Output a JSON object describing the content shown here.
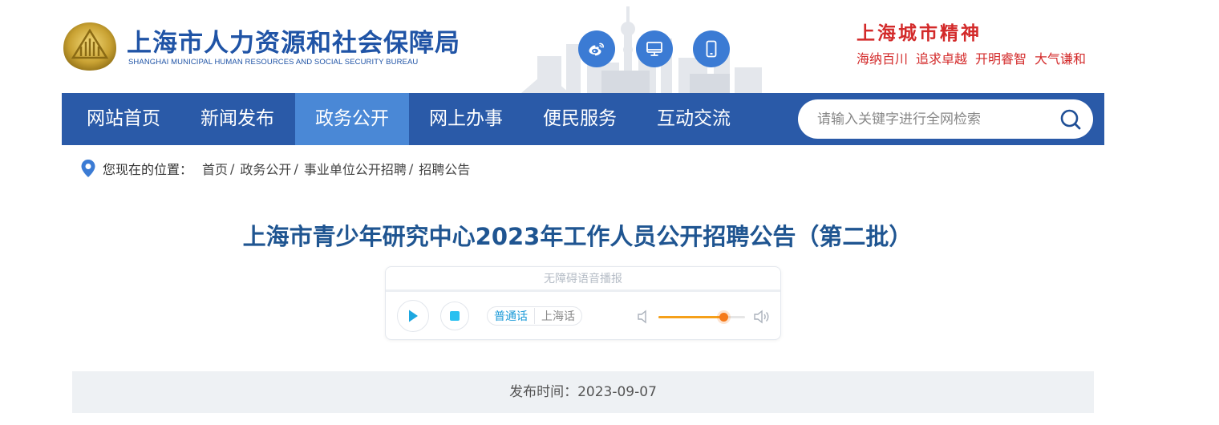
{
  "header": {
    "site_name_cn": "上海市人力资源和社会保障局",
    "site_name_en": "SHANGHAI MUNICIPAL HUMAN RESOURCES AND SOCIAL SECURITY BUREAU",
    "icons": [
      "weibo-icon",
      "desktop-icon",
      "mobile-icon"
    ],
    "city_spirit_title": "上海城市精神",
    "city_spirit_words": [
      "海纳百川",
      "追求卓越",
      "开明睿智",
      "大气谦和"
    ]
  },
  "nav": {
    "items": [
      {
        "label": "网站首页",
        "active": false
      },
      {
        "label": "新闻发布",
        "active": false
      },
      {
        "label": "政务公开",
        "active": true
      },
      {
        "label": "网上办事",
        "active": false
      },
      {
        "label": "便民服务",
        "active": false
      },
      {
        "label": "互动交流",
        "active": false
      }
    ],
    "search_placeholder": "请输入关键字进行全网检索"
  },
  "breadcrumb": {
    "prefix": "您现在的位置：",
    "items": [
      "首页",
      "政务公开",
      "事业单位公开招聘",
      "招聘公告"
    ],
    "separator": "/"
  },
  "article": {
    "title": "上海市青少年研究中心2023年工作人员公开招聘公告（第二批）",
    "publish_label": "发布时间：",
    "publish_date": "2023-09-07"
  },
  "player": {
    "header": "无障碍语音播报",
    "languages": [
      {
        "label": "普通话",
        "active": true
      },
      {
        "label": "上海话",
        "active": false
      }
    ],
    "volume": 0.75
  },
  "colors": {
    "nav_bg": "#2a5aa8",
    "nav_active": "#4a88d6",
    "title": "#1f5591",
    "spirit_red": "#d32a2a",
    "icon_blue": "#3b7bd4"
  }
}
